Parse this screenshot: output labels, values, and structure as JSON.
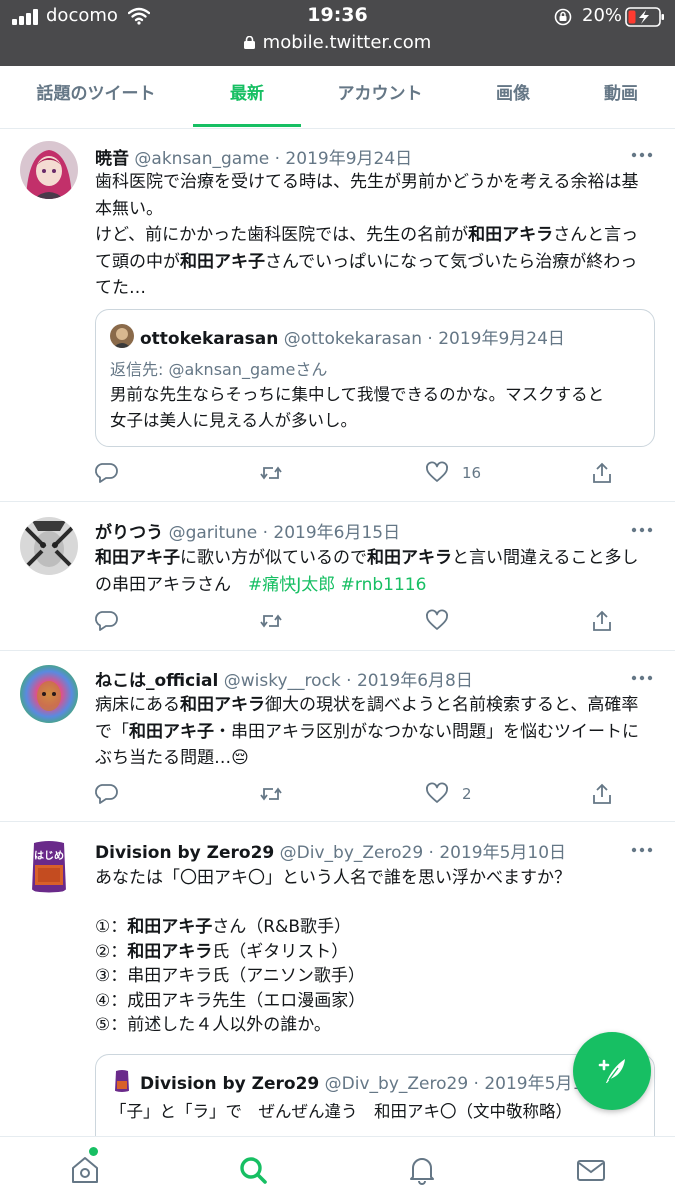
{
  "status_bar": {
    "carrier": "docomo",
    "time": "19:36",
    "battery_pct": "20%",
    "url": "mobile.twitter.com"
  },
  "tabs": [
    {
      "label": "話題のツイート",
      "active": false
    },
    {
      "label": "最新",
      "active": true
    },
    {
      "label": "アカウント",
      "active": false
    },
    {
      "label": "画像",
      "active": false
    },
    {
      "label": "動画",
      "active": false
    }
  ],
  "tweets": [
    {
      "name": "暁音",
      "meta": "@aknsan_game · 2019年9月24日",
      "body": [
        "歯科医院で治療を受けてる時は、先生が男前かどうかを考える余裕は基",
        "本無い。",
        "けど、前にかかった歯科医院では、先生の名前が",
        "和田アキラ",
        "さんと言っ",
        "て頭の中が",
        "和田アキ子",
        "さんでいっぱいになって気づいたら治療が終わっ",
        "てた…"
      ],
      "quote": {
        "name": "ottokekarasan",
        "meta": "@ottokekarasan · 2019年9月24日",
        "reply_to": "返信先: @aknsan_gameさん",
        "body": [
          "男前な先生ならそっちに集中して我慢できるのかな。マスクすると",
          "女子は美人に見える人が多いし。"
        ]
      },
      "likes": "16"
    },
    {
      "name": "がりつう",
      "meta": "@garitune · 2019年6月15日",
      "body": [
        "和田アキ子",
        "に歌い方が似ているので",
        "和田アキラ",
        "と言い間違えること多し",
        "の串田アキラさん　",
        "#痛快J太郎",
        "#rnb1116"
      ],
      "likes": ""
    },
    {
      "name": "ねこは_official",
      "meta": "@wisky__rock · 2019年6月8日",
      "body": [
        "病床にある",
        "和田アキラ",
        "御大の現状を調べようと名前検索すると、高確率",
        "で「",
        "和田アキ子",
        "・串田アキラ区別がなつかない問題」を悩むツイートに",
        "ぶち当たる問題…"
      ],
      "emoji": "😔",
      "likes": "2"
    },
    {
      "name": "Division by Zero29",
      "meta": "@Div_by_Zero29 · 2019年5月10日",
      "body": [
        "あなたは「〇田アキ〇」という人名で誰を思い浮かべますか？",
        "①：",
        "和田アキ子",
        "さん（R&B歌手）",
        "②：",
        "和田アキラ",
        "氏（ギタリスト）",
        "③：串田アキラ氏（アニソン歌手）",
        "④：成田アキラ先生（エロ漫画家）",
        "⑤：前述した４人以外の誰か。"
      ],
      "quote": {
        "name": "Division by Zero29",
        "meta": "@Div_by_Zero29 · 2019年5月10",
        "body": [
          "「子」と「ラ」で　ぜんぜん違う　和田アキ〇（文中敬称略）"
        ]
      },
      "avatar_text": "はじめ"
    }
  ],
  "icons": {
    "reply": "reply-icon",
    "retweet": "retweet-icon",
    "like": "heart-icon",
    "share": "share-icon",
    "more": "more-icon",
    "compose": "compose-tweet-icon",
    "nav": [
      "home-icon",
      "search-icon",
      "notifications-icon",
      "messages-icon"
    ]
  },
  "colors": {
    "accent": "#17bf63",
    "muted": "#657786",
    "text": "#14171a",
    "status_bar": "#4a4a4c",
    "divider": "#e6ecf0"
  }
}
